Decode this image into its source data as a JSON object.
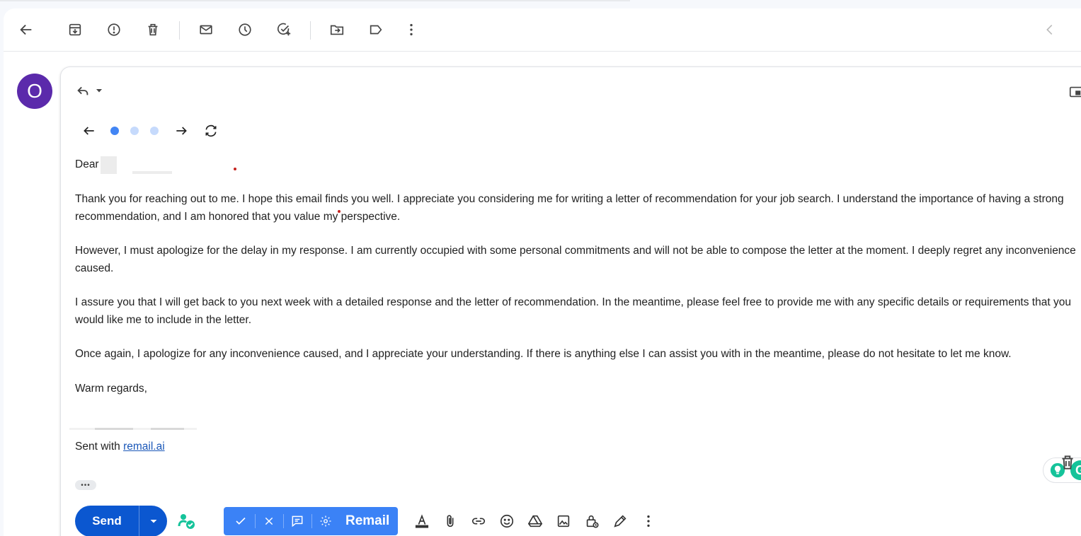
{
  "sender": {
    "avatar_letter": "O"
  },
  "toolbar": {
    "icons": [
      "back-arrow-icon",
      "archive-icon",
      "report-spam-icon",
      "delete-icon",
      "mark-unread-icon",
      "snooze-icon",
      "add-task-icon",
      "move-to-icon",
      "label-icon",
      "more-vert-icon",
      "older-chevron-icon"
    ]
  },
  "compose": {
    "greeting": "Dear",
    "paragraphs": [
      "Thank you for reaching out to me. I hope this email finds you well. I appreciate you considering me for writing a letter of recommendation for your job search. I understand the importance of having a strong recommendation, and I am honored that you value my perspective.",
      "However, I must apologize for the delay in my response. I am currently occupied with some personal commitments and will not be able to compose the letter at the moment. I deeply regret any inconvenience caused.",
      "I assure you that I will get back to you next week with a detailed response and the letter of recommendation. In the meantime, please feel free to provide me with any specific details or requirements that you would like me to include in the letter.",
      "Once again, I apologize for any inconvenience caused, and I appreciate your understanding. If there is anything else I can assist you with in the meantime, please do not hesitate to let me know."
    ],
    "closing": "Warm regards,",
    "sent_with_prefix": "Sent with ",
    "sent_with_link": "remail.ai",
    "suggestion_pages": {
      "total": 3,
      "current": 1
    }
  },
  "bottom": {
    "send_label": "Send",
    "remail_label": "Remail"
  },
  "grammarly": {
    "badge_count": "8",
    "logo_letter": "G"
  },
  "colors": {
    "accent": "#0b57d0",
    "remail": "#3b82f6",
    "avatar": "#5b2aab",
    "grammarly": "#15c39a"
  }
}
